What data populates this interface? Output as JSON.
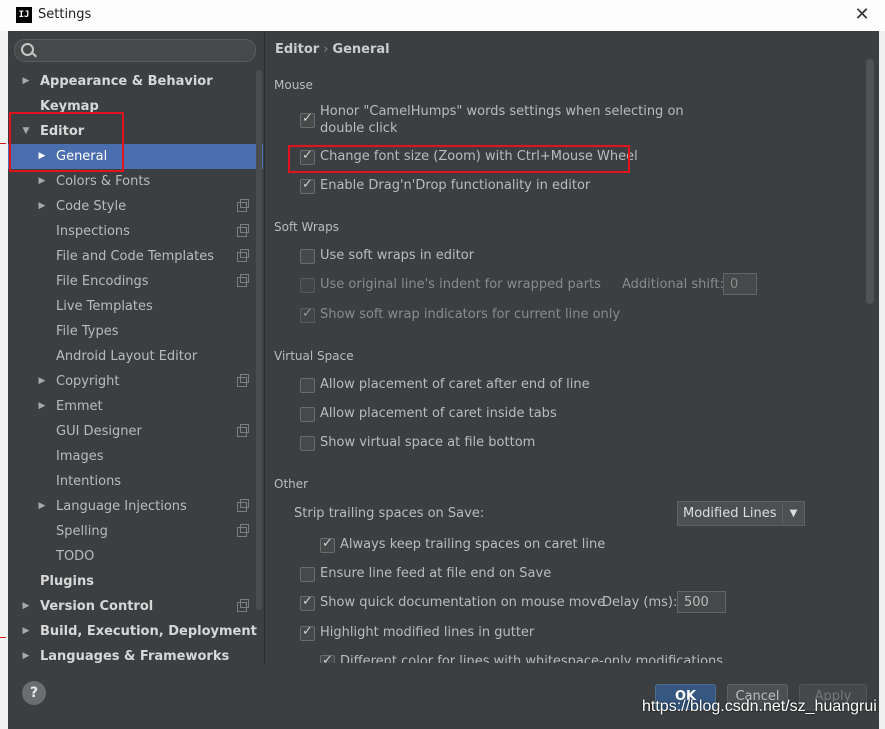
{
  "window": {
    "icon_text": "IJ",
    "title": "Settings",
    "close": "✕"
  },
  "search": {
    "placeholder": ""
  },
  "tree": [
    {
      "label": "Appearance & Behavior",
      "bold": true,
      "arrow": "▶",
      "indent": 0
    },
    {
      "label": "Keymap",
      "bold": true,
      "arrow": "",
      "indent": 0
    },
    {
      "label": "Editor",
      "bold": true,
      "arrow": "▼",
      "indent": 0
    },
    {
      "label": "General",
      "bold": false,
      "arrow": "▶",
      "indent": 1,
      "selected": true
    },
    {
      "label": "Colors & Fonts",
      "bold": false,
      "arrow": "▶",
      "indent": 1
    },
    {
      "label": "Code Style",
      "bold": false,
      "arrow": "▶",
      "indent": 1,
      "project": true
    },
    {
      "label": "Inspections",
      "bold": false,
      "arrow": "",
      "indent": 1,
      "project": true
    },
    {
      "label": "File and Code Templates",
      "bold": false,
      "arrow": "",
      "indent": 1,
      "project": true
    },
    {
      "label": "File Encodings",
      "bold": false,
      "arrow": "",
      "indent": 1,
      "project": true
    },
    {
      "label": "Live Templates",
      "bold": false,
      "arrow": "",
      "indent": 1
    },
    {
      "label": "File Types",
      "bold": false,
      "arrow": "",
      "indent": 1
    },
    {
      "label": "Android Layout Editor",
      "bold": false,
      "arrow": "",
      "indent": 1
    },
    {
      "label": "Copyright",
      "bold": false,
      "arrow": "▶",
      "indent": 1,
      "project": true
    },
    {
      "label": "Emmet",
      "bold": false,
      "arrow": "▶",
      "indent": 1
    },
    {
      "label": "GUI Designer",
      "bold": false,
      "arrow": "",
      "indent": 1,
      "project": true
    },
    {
      "label": "Images",
      "bold": false,
      "arrow": "",
      "indent": 1
    },
    {
      "label": "Intentions",
      "bold": false,
      "arrow": "",
      "indent": 1
    },
    {
      "label": "Language Injections",
      "bold": false,
      "arrow": "▶",
      "indent": 1,
      "project": true
    },
    {
      "label": "Spelling",
      "bold": false,
      "arrow": "",
      "indent": 1,
      "project": true
    },
    {
      "label": "TODO",
      "bold": false,
      "arrow": "",
      "indent": 1
    },
    {
      "label": "Plugins",
      "bold": true,
      "arrow": "",
      "indent": 0
    },
    {
      "label": "Version Control",
      "bold": true,
      "arrow": "▶",
      "indent": 0,
      "project": true
    },
    {
      "label": "Build, Execution, Deployment",
      "bold": true,
      "arrow": "▶",
      "indent": 0
    },
    {
      "label": "Languages & Frameworks",
      "bold": true,
      "arrow": "▶",
      "indent": 0
    }
  ],
  "breadcrumb": {
    "parent": "Editor",
    "separator": "›",
    "current": "General"
  },
  "sections": {
    "mouse": "Mouse",
    "soft_wraps": "Soft Wraps",
    "virtual_space": "Virtual Space",
    "other": "Other"
  },
  "mouse": {
    "camelhumps_line1": "Honor \"CamelHumps\" words settings when selecting on",
    "camelhumps_line2": "double click",
    "zoom": "Change font size (Zoom) with Ctrl+Mouse Wheel",
    "dragdrop": "Enable Drag'n'Drop functionality in editor"
  },
  "soft_wraps": {
    "use_soft_wraps": "Use soft wraps in editor",
    "original_indent": "Use original line's indent for wrapped parts",
    "additional_shift_label": "Additional shift:",
    "additional_shift_value": "0",
    "show_indicators": "Show soft wrap indicators for current line only"
  },
  "virtual_space": {
    "after_end": "Allow placement of caret after end of line",
    "inside_tabs": "Allow placement of caret inside tabs",
    "file_bottom": "Show virtual space at file bottom"
  },
  "other": {
    "strip_label": "Strip trailing spaces on Save:",
    "strip_value": "Modified Lines",
    "strip_arrow": "▼",
    "always_keep": "Always keep trailing spaces on caret line",
    "ensure_feed": "Ensure line feed at file end on Save",
    "quick_doc": "Show quick documentation on mouse move",
    "delay_label": "Delay (ms):",
    "delay_value": "500",
    "highlight_modified": "Highlight modified lines in gutter",
    "different_color": "Different color for lines with whitespace-only modifications"
  },
  "buttons": {
    "help": "?",
    "ok": "OK",
    "cancel": "Cancel",
    "apply": "Apply"
  },
  "watermark": "https://blog.csdn.net/sz_huangrui",
  "colors": {
    "selection": "#4b6eaf",
    "background": "#3c3f41",
    "annotation": "#e0141e"
  }
}
